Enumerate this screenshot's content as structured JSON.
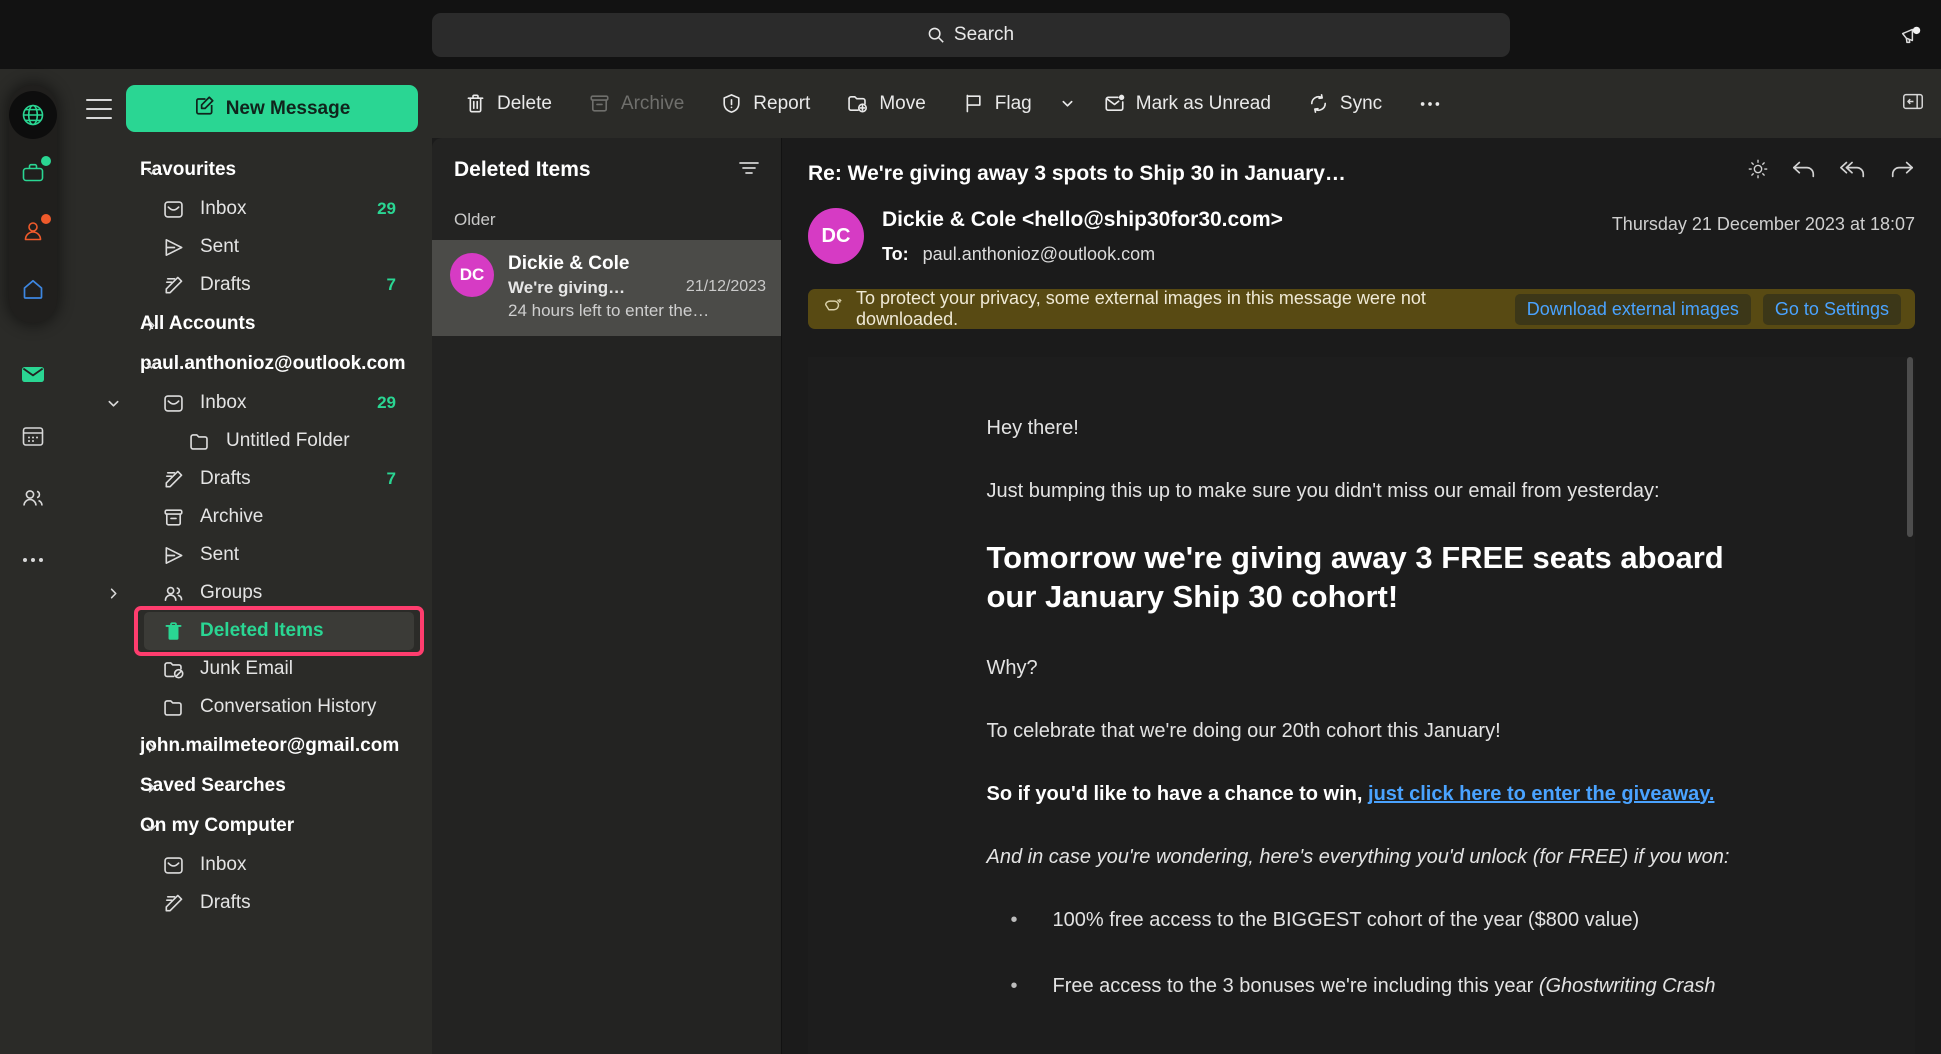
{
  "window": {
    "search": {
      "placeholder": "Search",
      "icon": "search-icon"
    },
    "announcement_icon": "megaphone-icon",
    "panel_toggle_icon": "collapse-panel-icon"
  },
  "rail": {
    "accounts": [
      {
        "name": "globe-account",
        "icon": "globe-icon",
        "color": "#2ad693",
        "active": true,
        "dot": null
      },
      {
        "name": "work-account",
        "icon": "briefcase-icon",
        "color": "#2ad693",
        "dot": "#2ad693"
      },
      {
        "name": "personal-account",
        "icon": "person-icon",
        "color": "#ef5a2b",
        "dot": "#ef5a2b"
      },
      {
        "name": "home-account",
        "icon": "home-icon",
        "color": "#3d86e0",
        "dot": null
      }
    ],
    "modules": [
      {
        "name": "mail-module",
        "icon": "mail-icon",
        "color": "#2ad693",
        "active": true
      },
      {
        "name": "calendar-module",
        "icon": "calendar-icon",
        "color": "#d8d8d8"
      },
      {
        "name": "contacts-module",
        "icon": "contacts-icon",
        "color": "#d8d8d8"
      },
      {
        "name": "more-modules",
        "icon": "ellipsis-icon",
        "color": "#d8d8d8"
      }
    ]
  },
  "sidebar": {
    "menu_icon": "hamburger-icon",
    "new_message": {
      "label": "New Message",
      "icon": "compose-icon"
    },
    "sections": [
      {
        "id": "favourites",
        "label": "Favourites",
        "expanded": true,
        "chevron": "chevron-down-icon",
        "items": [
          {
            "label": "Inbox",
            "icon": "inbox-icon",
            "count": "29",
            "indent": 1
          },
          {
            "label": "Sent",
            "icon": "sent-icon",
            "count": "",
            "indent": 1
          },
          {
            "label": "Drafts",
            "icon": "drafts-icon",
            "count": "7",
            "indent": 1
          }
        ]
      },
      {
        "id": "all-accounts",
        "label": "All Accounts",
        "expanded": false,
        "chevron": "chevron-right-icon",
        "items": []
      },
      {
        "id": "paul-outlook",
        "label": "paul.anthonioz@outlook.com",
        "expanded": true,
        "chevron": "chevron-down-icon",
        "items": [
          {
            "label": "Inbox",
            "icon": "inbox-icon",
            "count": "29",
            "indent": 1,
            "caret": "chevron-down-icon"
          },
          {
            "label": "Untitled Folder",
            "icon": "folder-icon",
            "count": "",
            "indent": 2
          },
          {
            "label": "Drafts",
            "icon": "drafts-icon",
            "count": "7",
            "indent": 1
          },
          {
            "label": "Archive",
            "icon": "archive-icon",
            "count": "",
            "indent": 1
          },
          {
            "label": "Sent",
            "icon": "sent-icon",
            "count": "",
            "indent": 1
          },
          {
            "label": "Groups",
            "icon": "groups-icon",
            "count": "",
            "indent": 1,
            "caret": "chevron-right-icon"
          },
          {
            "label": "Deleted Items",
            "icon": "trash-icon",
            "count": "",
            "indent": 1,
            "selected": true,
            "highlighted": true
          },
          {
            "label": "Junk Email",
            "icon": "junk-icon",
            "count": "",
            "indent": 1
          },
          {
            "label": "Conversation History",
            "icon": "folder-icon",
            "count": "",
            "indent": 1
          }
        ]
      },
      {
        "id": "john-gmail",
        "label": "john.mailmeteor@gmail.com",
        "expanded": false,
        "chevron": "chevron-right-icon",
        "items": []
      },
      {
        "id": "saved-searches",
        "label": "Saved Searches",
        "expanded": false,
        "chevron": "chevron-right-icon",
        "items": []
      },
      {
        "id": "on-my-computer",
        "label": "On my Computer",
        "expanded": true,
        "chevron": "chevron-down-icon",
        "items": [
          {
            "label": "Inbox",
            "icon": "inbox-icon",
            "count": "",
            "indent": 1
          },
          {
            "label": "Drafts",
            "icon": "drafts-icon",
            "count": "",
            "indent": 1
          }
        ]
      }
    ],
    "highlight_color": "#ff3d6e",
    "accent_color": "#2ad693"
  },
  "toolbar": {
    "buttons": [
      {
        "label": "Delete",
        "icon": "trash-icon",
        "disabled": false
      },
      {
        "label": "Archive",
        "icon": "archive-icon",
        "disabled": true
      },
      {
        "label": "Report",
        "icon": "report-icon",
        "disabled": false
      },
      {
        "label": "Move",
        "icon": "move-icon",
        "disabled": false
      },
      {
        "label": "Flag",
        "icon": "flag-icon",
        "disabled": false,
        "chevron": "chevron-down-icon"
      },
      {
        "label": "Mark as Unread",
        "icon": "unread-icon",
        "disabled": false
      },
      {
        "label": "Sync",
        "icon": "sync-icon",
        "disabled": false
      }
    ],
    "overflow_icon": "ellipsis-icon",
    "right_toggle_icon": "collapse-reading-pane-icon"
  },
  "message_list": {
    "title": "Deleted Items",
    "filter_icon": "filter-icon",
    "sections": [
      {
        "label": "Older",
        "messages": [
          {
            "initials": "DC",
            "from": "Dickie & Cole",
            "subject": "We're giving…",
            "date": "21/12/2023",
            "preview": "24 hours left to enter the…",
            "selected": true,
            "avatar_color": "#d63bc4"
          }
        ]
      }
    ]
  },
  "reader": {
    "subject": "Re: We're giving away 3 spots to Ship 30 in January…",
    "actions": [
      {
        "name": "brightness-icon"
      },
      {
        "name": "reply-icon"
      },
      {
        "name": "reply-all-icon"
      },
      {
        "name": "forward-icon"
      }
    ],
    "sender": {
      "initials": "DC",
      "name": "Dickie & Cole <hello@ship30for30.com>",
      "avatar_color": "#d63bc4"
    },
    "to_label": "To:",
    "to_value": "paul.anthonioz@outlook.com",
    "sent_date": "Thursday 21 December 2023 at 18:07",
    "privacy_banner": {
      "icon": "privacy-shield-icon",
      "text": "To protect your privacy, some external images in this message were not downloaded.",
      "download_label": "Download external images",
      "settings_label": "Go to Settings",
      "background": "#584a13",
      "link_color": "#4aa3ff"
    },
    "body": {
      "greeting": "Hey there!",
      "intro": "Just bumping this up to make sure you didn't miss our email from yesterday:",
      "headline": "Tomorrow we're giving away 3 FREE seats aboard our January Ship 30 cohort!",
      "why": "Why?",
      "celebrate": "To celebrate that we're doing our 20th cohort this January!",
      "cta_prefix": "So if you'd like to have a chance to win, ",
      "cta_link": "just click here to enter the giveaway.",
      "unlock_intro": "And in case you're wondering, here's everything you'd unlock (for FREE) if you won:",
      "bullets": [
        "100% free access to the BIGGEST cohort of the year ($800 value)",
        "Free access to the 3 bonuses we're including this year (Ghostwriting Crash"
      ]
    }
  }
}
